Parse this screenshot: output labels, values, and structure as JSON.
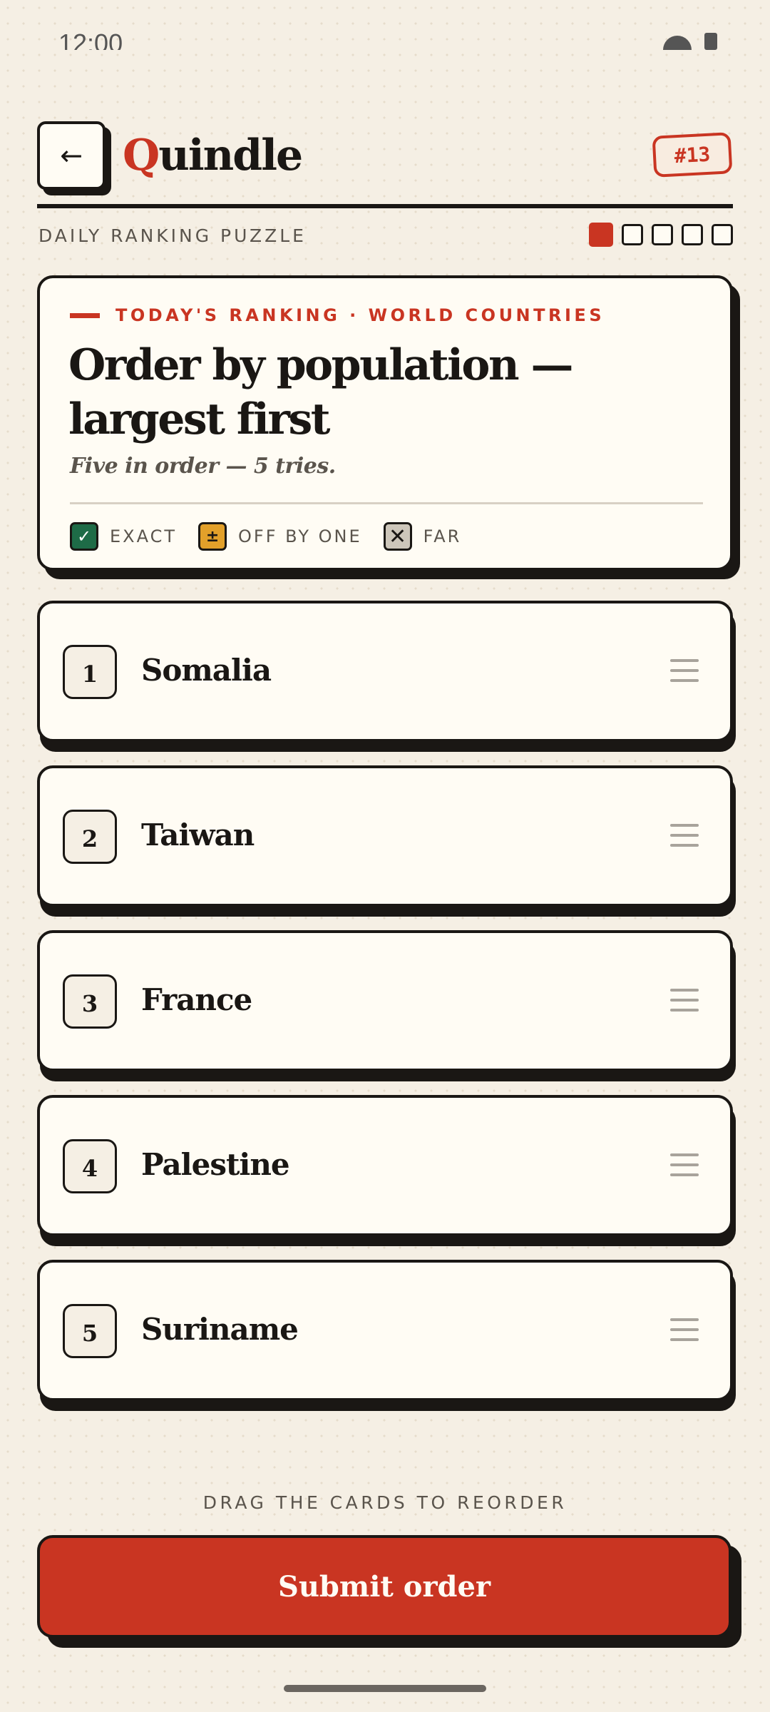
{
  "status_bar": {
    "time": "12:00"
  },
  "header": {
    "back_icon": "arrow-left-icon",
    "back_glyph": "←",
    "logo_first": "Q",
    "logo_rest": "uindle",
    "puzzle_number": "#13"
  },
  "subheader": {
    "label": "DAILY RANKING PUZZLE",
    "attempts_total": 5,
    "attempts_active_index": 0
  },
  "prompt": {
    "eyebrow": "TODAY'S RANKING · WORLD COUNTRIES",
    "headline_start": "Order by population — largest ",
    "headline_highlight": "first",
    "tagline": "Five in order — 5 tries.",
    "legend": [
      {
        "symbol": "✓",
        "label": "EXACT",
        "color": "#1e6b47"
      },
      {
        "symbol": "±",
        "label": "OFF BY ONE",
        "color": "#e2a02a"
      },
      {
        "symbol": "✕",
        "label": "FAR",
        "color": "#cdc6ba"
      }
    ]
  },
  "ranking": [
    {
      "rank": "1",
      "name": "Somalia"
    },
    {
      "rank": "2",
      "name": "Taiwan"
    },
    {
      "rank": "3",
      "name": "France"
    },
    {
      "rank": "4",
      "name": "Palestine"
    },
    {
      "rank": "5",
      "name": "Suriname"
    }
  ],
  "hint": "DRAG THE CARDS TO REORDER",
  "submit_label": "Submit order",
  "colors": {
    "accent": "#c93522",
    "ink": "#1a1714",
    "paper": "#fffcf4",
    "background": "#f5efe4"
  }
}
